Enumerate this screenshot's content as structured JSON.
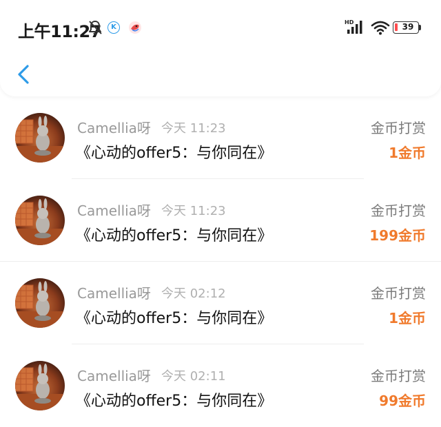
{
  "status_bar": {
    "time": "上午11:27",
    "k_badge": "K",
    "battery": "39",
    "icons": [
      "bell-off-icon",
      "k-app-icon",
      "bird-app-icon",
      "hd-signal-icon",
      "wifi-icon",
      "battery-icon"
    ]
  },
  "header": {
    "back_icon": "chevron-left-icon",
    "accent": "#2d9be8"
  },
  "colors": {
    "amount": "#f07a2c",
    "name": "#999999",
    "type": "#7a7a7a"
  },
  "rewards": [
    {
      "user": "Camellia呀",
      "time": "今天 11:23",
      "title": "《心动的offer5：与你同在》",
      "type": "金币打赏",
      "amount": "1金币"
    },
    {
      "user": "Camellia呀",
      "time": "今天 11:23",
      "title": "《心动的offer5：与你同在》",
      "type": "金币打赏",
      "amount": "199金币"
    },
    {
      "user": "Camellia呀",
      "time": "今天 02:12",
      "title": "《心动的offer5：与你同在》",
      "type": "金币打赏",
      "amount": "1金币"
    },
    {
      "user": "Camellia呀",
      "time": "今天 02:11",
      "title": "《心动的offer5：与你同在》",
      "type": "金币打赏",
      "amount": "99金币"
    }
  ]
}
